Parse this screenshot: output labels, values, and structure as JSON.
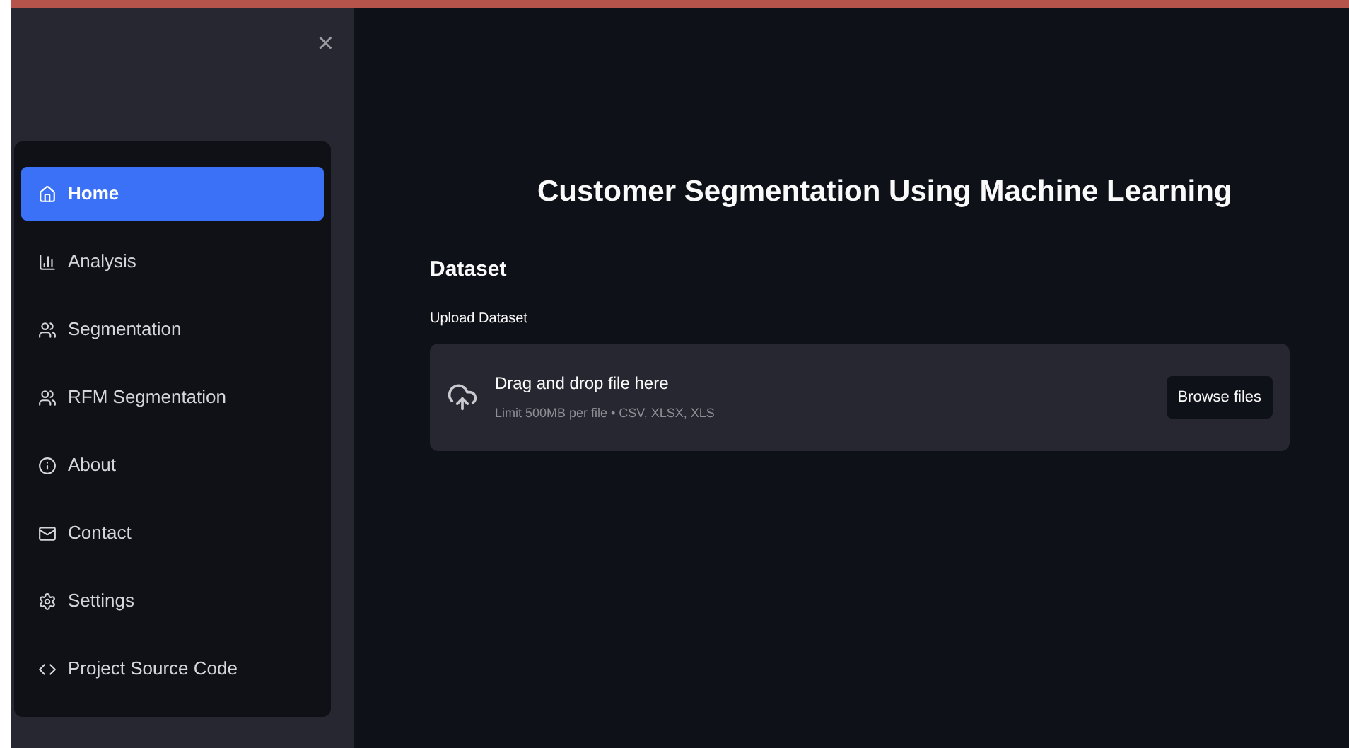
{
  "sidebar": {
    "close": "×",
    "items": [
      {
        "label": "Home",
        "selected": true
      },
      {
        "label": "Analysis",
        "selected": false
      },
      {
        "label": "Segmentation",
        "selected": false
      },
      {
        "label": "RFM Segmentation",
        "selected": false
      },
      {
        "label": "About",
        "selected": false
      },
      {
        "label": "Contact",
        "selected": false
      },
      {
        "label": "Settings",
        "selected": false
      },
      {
        "label": "Project Source Code",
        "selected": false
      }
    ]
  },
  "main": {
    "title": "Customer Segmentation Using Machine Learning",
    "section": "Dataset",
    "uploader": {
      "label": "Upload Dataset",
      "prompt": "Drag and drop file here",
      "limit": "Limit 500MB per file • CSV, XLSX, XLS",
      "button": "Browse files"
    }
  }
}
